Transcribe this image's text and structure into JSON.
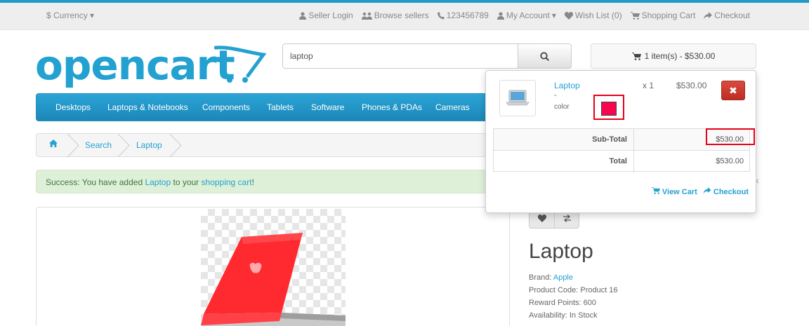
{
  "topbar": {
    "currency": "$ Currency",
    "links": [
      "Seller Login",
      "Browse sellers",
      "123456789",
      "My Account",
      "Wish List (0)",
      "Shopping Cart",
      "Checkout"
    ]
  },
  "logo": {
    "text": "opencart"
  },
  "search": {
    "value": "laptop"
  },
  "cart_button": {
    "label": "1 item(s) - $530.00"
  },
  "menu": {
    "items": [
      "Desktops",
      "Laptops & Notebooks",
      "Components",
      "Tablets",
      "Software",
      "Phones & PDAs",
      "Cameras"
    ]
  },
  "breadcrumb": {
    "items": [
      "Search",
      "Laptop"
    ]
  },
  "alert": {
    "prefix": "Success: You have added ",
    "product": "Laptop",
    "middle": " to your ",
    "cart": "shopping cart",
    "suffix": "!"
  },
  "product": {
    "title": "Laptop",
    "brand_label": "Brand: ",
    "brand": "Apple",
    "code": "Product Code: Product 16",
    "reward": "Reward Points: 600",
    "availability": "Availability: In Stock"
  },
  "cart_dropdown": {
    "item_name": "Laptop",
    "item_dash": "-",
    "item_option": "color",
    "swatch_color": "#f7064f",
    "qty": "x 1",
    "price": "$530.00",
    "subtotal_label": "Sub-Total",
    "subtotal_value": "$530.00",
    "total_label": "Total",
    "total_value": "$530.00",
    "view_cart": "View Cart",
    "checkout": "Checkout"
  },
  "colors": {
    "accent": "#23a1d1",
    "highlight": "#e8001a"
  }
}
